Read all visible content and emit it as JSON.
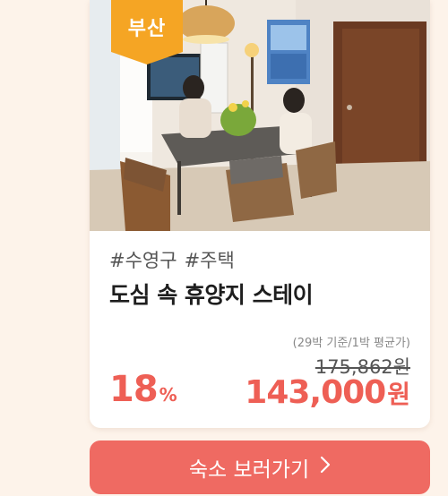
{
  "card": {
    "region_badge": "부산",
    "tags": [
      "#수영구",
      "#주택"
    ],
    "title": "도심 속 휴양지 스테이",
    "price_basis": "(29박 기준/1박 평균가)",
    "original_price": "175,862원",
    "discount_value": "18",
    "discount_unit": "%",
    "sale_price_amount": "143,000",
    "sale_price_currency": "원",
    "accent_color": "#ee5f55",
    "badge_color": "#f5a524"
  },
  "cta": {
    "label": "숙소 보러가기",
    "icon": "chevron-right-icon"
  }
}
